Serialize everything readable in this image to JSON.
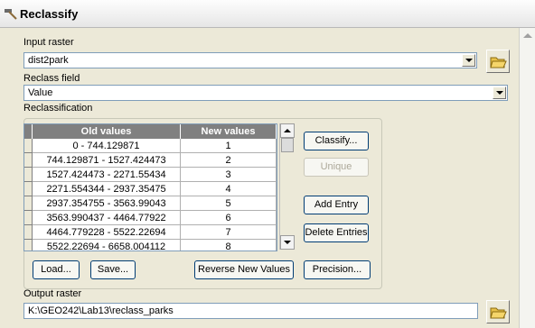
{
  "window": {
    "title": "Reclassify"
  },
  "input_raster": {
    "label": "Input raster",
    "value": "dist2park"
  },
  "reclass_field": {
    "label": "Reclass field",
    "value": "Value"
  },
  "reclassification": {
    "label": "Reclassification",
    "columns": [
      "Old values",
      "New values"
    ],
    "rows": [
      {
        "old": "0 - 744.129871",
        "new": "1"
      },
      {
        "old": "744.129871 - 1527.424473",
        "new": "2"
      },
      {
        "old": "1527.424473 - 2271.55434",
        "new": "3"
      },
      {
        "old": "2271.554344 - 2937.35475",
        "new": "4"
      },
      {
        "old": "2937.354755 - 3563.99043",
        "new": "5"
      },
      {
        "old": "3563.990437 - 4464.77922",
        "new": "6"
      },
      {
        "old": "4464.779228 - 5522.22694",
        "new": "7"
      },
      {
        "old": "5522.22694 - 6658.004112",
        "new": "8"
      }
    ]
  },
  "buttons": {
    "classify": "Classify...",
    "unique": "Unique",
    "add_entry": "Add Entry",
    "delete_entries": "Delete Entries",
    "load": "Load...",
    "save": "Save...",
    "reverse": "Reverse New Values",
    "precision": "Precision..."
  },
  "output_raster": {
    "label": "Output raster",
    "value": "K:\\GEO242\\Lab13\\reclass_parks"
  }
}
